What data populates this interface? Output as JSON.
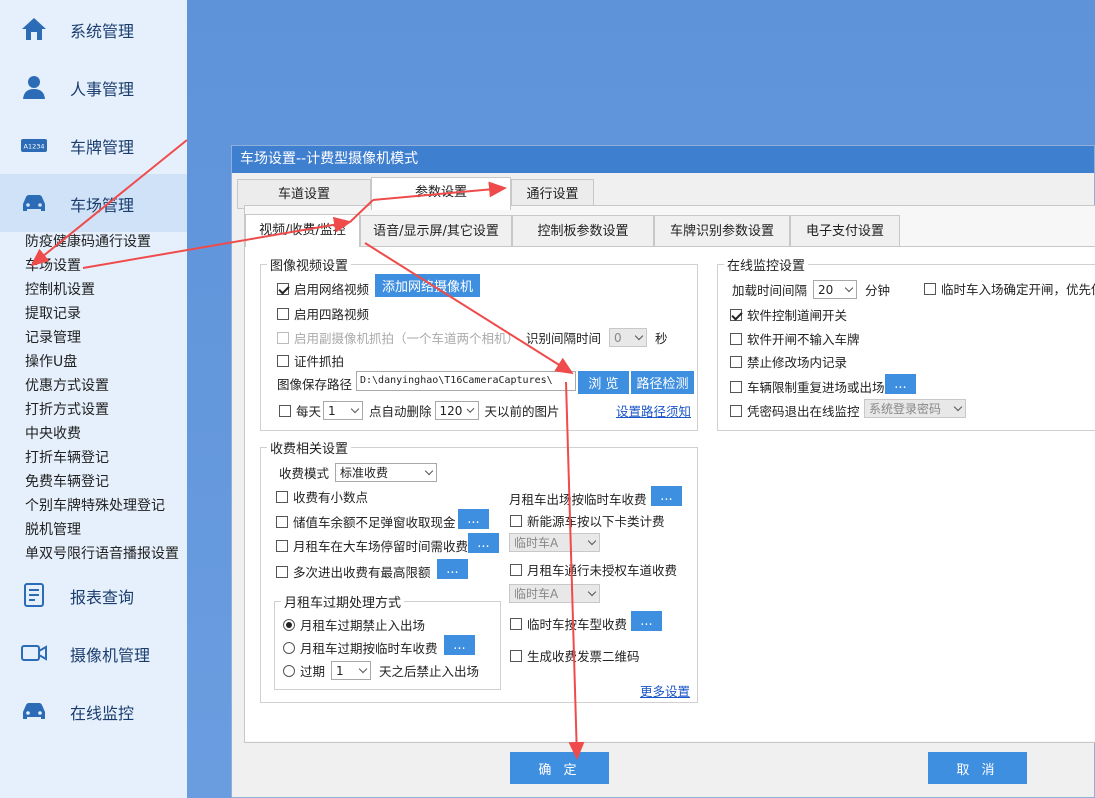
{
  "sidebar": {
    "items": [
      {
        "label": "系统管理",
        "icon": "home-icon"
      },
      {
        "label": "人事管理",
        "icon": "user-icon"
      },
      {
        "label": "车牌管理",
        "icon": "license-plate-icon",
        "icon_text": "A1234"
      },
      {
        "label": "车场管理",
        "icon": "car-icon"
      },
      {
        "label": "报表查询",
        "icon": "report-icon"
      },
      {
        "label": "摄像机管理",
        "icon": "camera-icon"
      },
      {
        "label": "在线监控",
        "icon": "car-monitor-icon"
      }
    ],
    "subitems": [
      "防疫健康码通行设置",
      "车场设置",
      "控制机设置",
      "提取记录",
      "记录管理",
      "操作U盘",
      "优惠方式设置",
      "打折方式设置",
      "中央收费",
      "打折车辆登记",
      "免费车辆登记",
      "个别车牌特殊处理登记",
      "脱机管理",
      "单双号限行语音播报设置"
    ]
  },
  "dialog": {
    "title": "车场设置--计费型摄像机模式",
    "tabs": [
      "车道设置",
      "参数设置",
      "通行设置"
    ],
    "subtabs": [
      "视频/收费/监控",
      "语音/显示屏/其它设置",
      "控制板参数设置",
      "车牌识别参数设置",
      "电子支付设置"
    ],
    "video": {
      "legend": "图像视频设置",
      "enable_net": "启用网络视频",
      "add_camera": "添加网络摄像机",
      "enable_four": "启用四路视频",
      "enable_sub": "启用副摄像机抓拍（一个车道两个相机）",
      "interval_label": "识别间隔时间",
      "interval_value": "0",
      "interval_unit": "秒",
      "cert": "证件抓拍",
      "path_label": "图像保存路径",
      "path_value": "D:\\danyinghao\\T16CameraCaptures\\",
      "browse": "浏 览",
      "check": "路径检测",
      "daily": "每天",
      "daily_value": "1",
      "auto_del": "点自动删除",
      "days_value": "120",
      "days_suffix": "天以前的图片",
      "path_notice": "设置路径须知"
    },
    "online": {
      "legend": "在线监控设置",
      "load_label": "加载时间间隔",
      "load_value": "20",
      "load_unit": "分钟",
      "temp_confirm": "临时车入场确定开闸，优先保",
      "soft_ctrl": "软件控制道闸开关",
      "no_plate": "软件开闸不输入车牌",
      "no_edit": "禁止修改场内记录",
      "limit_repeat": "车辆限制重复进场或出场",
      "pwd_exit": "凭密码退出在线监控",
      "pwd_value": "系统登录密码"
    },
    "charge": {
      "legend": "收费相关设置",
      "mode_label": "收费模式",
      "mode_value": "标准收费",
      "decimal": "收费有小数点",
      "stored_popup": "储值车余额不足弹窗收取现金",
      "monthly_stay": "月租车在大车场停留时间需收费",
      "multi_max": "多次进出收费有最高限额",
      "monthly_out_temp": "月租车出场按临时车收费",
      "new_energy": "新能源车按以下卡类计费",
      "car_a1": "临时车A",
      "monthly_unauth": "月租车通行未授权车道收费",
      "car_a2": "临时车A",
      "temp_by_type": "临时车按车型收费",
      "invoice_qr": "生成收费发票二维码",
      "more": "更多设置",
      "expire": {
        "legend": "月租车过期处理方式",
        "opt1": "月租车过期禁止入出场",
        "opt2": "月租车过期按临时车收费",
        "opt3_prefix": "过期",
        "opt3_value": "1",
        "opt3_suffix": "天之后禁止入出场"
      }
    },
    "dots": "...",
    "ok": "确 定",
    "cancel": "取 消"
  },
  "colors": {
    "accent": "#3f8fe0",
    "title_bar": "#3f7fd0",
    "sidebar": "#e6f0fc",
    "arrow": "#ef4b4b"
  }
}
